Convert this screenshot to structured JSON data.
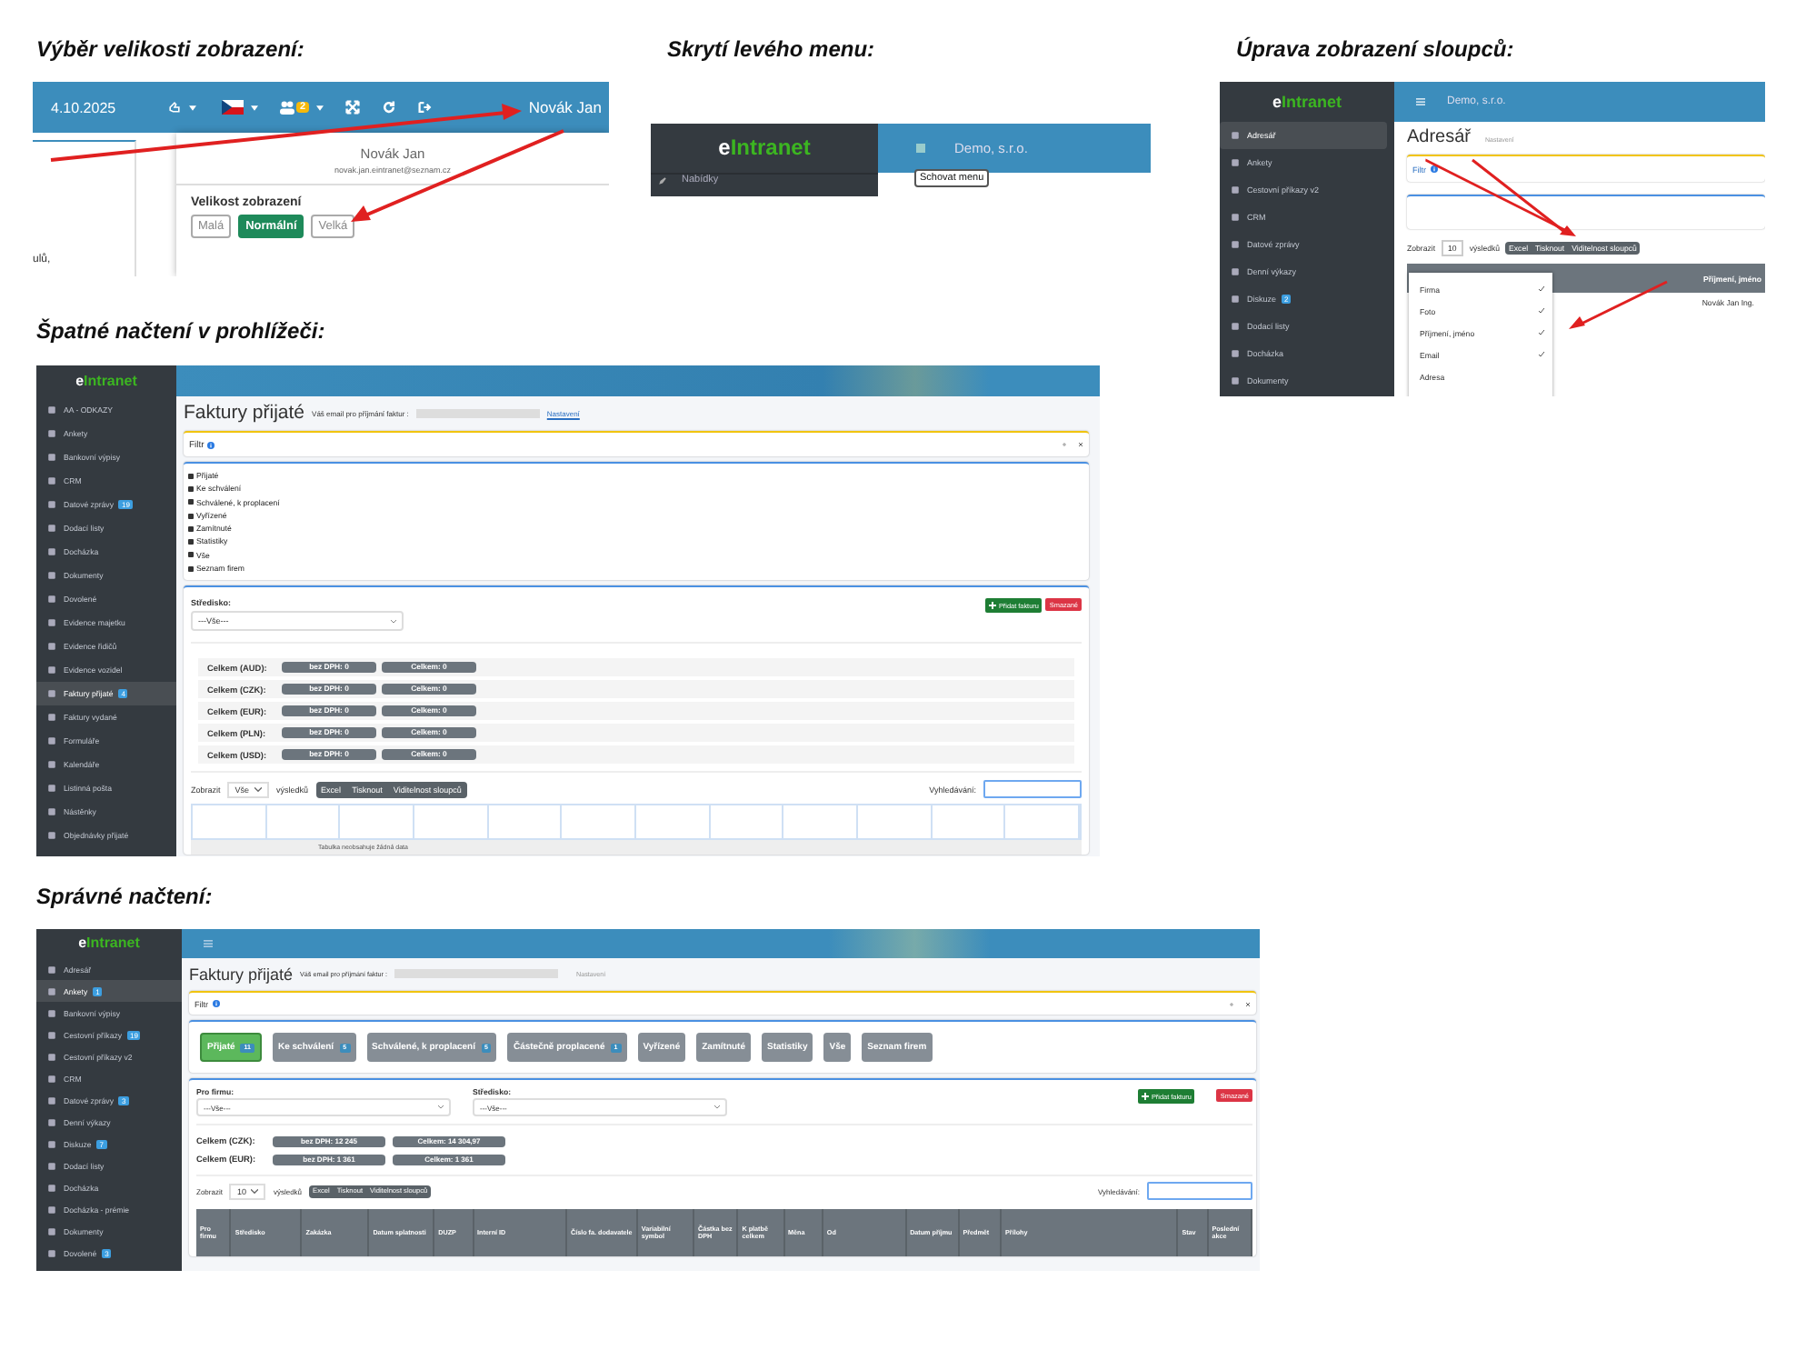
{
  "display_size": {
    "title": "Výběr velikosti zobrazení:",
    "date": "4.10.2025",
    "notification_count": "2",
    "user": "Novák Jan",
    "background_text": "ulů,",
    "menu": {
      "name": "Novák Jan",
      "email": "novak.jan.eintranet@seznam.cz",
      "size_label": "Velikost zobrazení",
      "sizes": [
        {
          "label": "Malá",
          "selected": false
        },
        {
          "label": "Normální",
          "selected": true
        },
        {
          "label": "Velká",
          "selected": false
        }
      ]
    }
  },
  "hide_menu": {
    "title": "Skrytí levého menu:",
    "logo": "eIntranet",
    "company": "Demo, s.r.o.",
    "tooltip": "Schovat menu",
    "menu_item": "Nabídky"
  },
  "column_visibility": {
    "title": "Úprava zobrazení sloupců:",
    "logo": "eIntranet",
    "company": "Demo, s.r.o.",
    "sidebar": [
      {
        "label": "Adresář",
        "selected": true
      },
      {
        "label": "Ankety",
        "selected": false
      },
      {
        "label": "Cestovní příkazy v2",
        "selected": false
      },
      {
        "label": "CRM",
        "selected": false
      },
      {
        "label": "Datové zprávy",
        "selected": false
      },
      {
        "label": "Denní výkazy",
        "selected": false
      },
      {
        "label": "Diskuze",
        "badge": "2",
        "selected": false
      },
      {
        "label": "Dodací listy",
        "selected": false
      },
      {
        "label": "Docházka",
        "selected": false
      },
      {
        "label": "Dokumenty",
        "selected": false
      }
    ],
    "page_title": "Adresář",
    "settings_link": "Nastavení",
    "filter": "Filtr",
    "show_label": "Zobrazit",
    "page_length": "10",
    "results_label": "výsledků",
    "buttons": [
      "Excel",
      "Tisknout",
      "Viditelnost sloupců"
    ],
    "column_menu": [
      {
        "label": "Firma",
        "checked": true
      },
      {
        "label": "Foto",
        "checked": true
      },
      {
        "label": "Příjmení, jméno",
        "checked": true
      },
      {
        "label": "Email",
        "checked": true
      },
      {
        "label": "Adresa",
        "checked": false
      }
    ],
    "table_header": "Příjmení, jméno",
    "table_cell": "Novák Jan Ing."
  },
  "broken_loading": {
    "title": "Špatné načtení v prohlížeči:",
    "logo": "eIntranet",
    "sidebar": [
      {
        "label": "AA - ODKAZY",
        "selected": false
      },
      {
        "label": "Ankety",
        "selected": false
      },
      {
        "label": "Bankovní výpisy",
        "selected": false
      },
      {
        "label": "CRM",
        "selected": false
      },
      {
        "label": "Datové zprávy",
        "badge": "19",
        "selected": false
      },
      {
        "label": "Dodací listy",
        "selected": false
      },
      {
        "label": "Docházka",
        "selected": false
      },
      {
        "label": "Dokumenty",
        "selected": false
      },
      {
        "label": "Dovolené",
        "selected": false
      },
      {
        "label": "Evidence majetku",
        "selected": false
      },
      {
        "label": "Evidence řidičů",
        "selected": false
      },
      {
        "label": "Evidence vozidel",
        "selected": false
      },
      {
        "label": "Faktury přijaté",
        "badge": "4",
        "selected": true
      },
      {
        "label": "Faktury vydané",
        "selected": false
      },
      {
        "label": "Formuláře",
        "selected": false
      },
      {
        "label": "Kalendáře",
        "selected": false
      },
      {
        "label": "Listinná pošta",
        "selected": false
      },
      {
        "label": "Nástěnky",
        "selected": false
      },
      {
        "label": "Objednávky přijaté",
        "selected": false
      }
    ],
    "page_title": "Faktury přijaté",
    "email_label": "Váš email pro příjmání faktur :",
    "settings_link": "Nastavení",
    "filter": "Filtr",
    "tabs": [
      "Přijaté",
      "Ke schválení",
      "Schválené, k proplacení",
      "Vyřízené",
      "Zamítnuté",
      "Statistiky",
      "Vše",
      "Seznam firem"
    ],
    "center_label": "Středisko:",
    "center_value": "---Vše---",
    "add_button": "Přidat fakturu",
    "deleted_button": "Smazané",
    "totals": [
      {
        "label": "Celkem (AUD):",
        "net": "bez DPH: 0",
        "total": "Celkem: 0"
      },
      {
        "label": "Celkem (CZK):",
        "net": "bez DPH: 0",
        "total": "Celkem: 0"
      },
      {
        "label": "Celkem (EUR):",
        "net": "bez DPH: 0",
        "total": "Celkem: 0"
      },
      {
        "label": "Celkem (PLN):",
        "net": "bez DPH: 0",
        "total": "Celkem: 0"
      },
      {
        "label": "Celkem (USD):",
        "net": "bez DPH: 0",
        "total": "Celkem: 0"
      }
    ],
    "show_label": "Zobrazit",
    "page_length": "Vše",
    "results_label": "výsledků",
    "buttons": [
      "Excel",
      "Tisknout",
      "Viditelnost sloupců"
    ],
    "search_label": "Vyhledávání:",
    "empty_text": "Tabulka neobsahuje žádná data"
  },
  "correct_loading": {
    "title": "Správné načtení:",
    "logo": "eIntranet",
    "sidebar": [
      {
        "label": "Adresář",
        "selected": false
      },
      {
        "label": "Ankety",
        "badge": "1",
        "selected": true
      },
      {
        "label": "Bankovní výpisy",
        "selected": false
      },
      {
        "label": "Cestovní příkazy",
        "badge": "19",
        "selected": false
      },
      {
        "label": "Cestovní příkazy v2",
        "selected": false
      },
      {
        "label": "CRM",
        "selected": false
      },
      {
        "label": "Datové zprávy",
        "badge": "3",
        "selected": false
      },
      {
        "label": "Denní výkazy",
        "selected": false
      },
      {
        "label": "Diskuze",
        "badge": "7",
        "selected": false
      },
      {
        "label": "Dodací listy",
        "selected": false
      },
      {
        "label": "Docházka",
        "selected": false
      },
      {
        "label": "Docházka - prémie",
        "selected": false
      },
      {
        "label": "Dokumenty",
        "selected": false
      },
      {
        "label": "Dovolené",
        "badge": "3",
        "selected": false
      }
    ],
    "page_title": "Faktury přijaté",
    "email_label": "Váš email pro příjmání faktur :",
    "settings_link": "Nastavení",
    "filter": "Filtr",
    "tabs": [
      {
        "label": "Přijaté",
        "badge": "11",
        "selected": true
      },
      {
        "label": "Ke schválení",
        "badge": "5",
        "selected": false
      },
      {
        "label": "Schválené, k proplacení",
        "badge": "5",
        "selected": false
      },
      {
        "label": "Částečně proplacené",
        "badge": "1",
        "selected": false
      },
      {
        "label": "Vyřízené",
        "selected": false
      },
      {
        "label": "Zamítnuté",
        "selected": false
      },
      {
        "label": "Statistiky",
        "selected": false
      },
      {
        "label": "Vše",
        "selected": false
      },
      {
        "label": "Seznam firem",
        "selected": false
      }
    ],
    "filters": [
      {
        "label": "Pro firmu:",
        "value": "---Vše---"
      },
      {
        "label": "Středisko:",
        "value": "---Vše---"
      }
    ],
    "add_button": "Přidat fakturu",
    "deleted_button": "Smazané",
    "totals": [
      {
        "label": "Celkem (CZK):",
        "net": "bez DPH: 12 245",
        "total": "Celkem: 14 304,97"
      },
      {
        "label": "Celkem (EUR):",
        "net": "bez DPH: 1 361",
        "total": "Celkem: 1 361"
      }
    ],
    "show_label": "Zobrazit",
    "page_length": "10",
    "results_label": "výsledků",
    "buttons": [
      "Excel",
      "Tisknout",
      "Viditelnost sloupců"
    ],
    "search_label": "Vyhledávání:",
    "columns": [
      "Pro firmu",
      "Středisko",
      "Zakázka",
      "Datum splatnosti",
      "DUZP",
      "Interní ID",
      "Číslo fa. dodavatele",
      "Variabilní symbol",
      "Částka bez DPH",
      "K platbě celkem",
      "Měna",
      "Od",
      "Datum příjmu",
      "Předmět",
      "Přílohy",
      "Stav",
      "Poslední akce"
    ]
  }
}
